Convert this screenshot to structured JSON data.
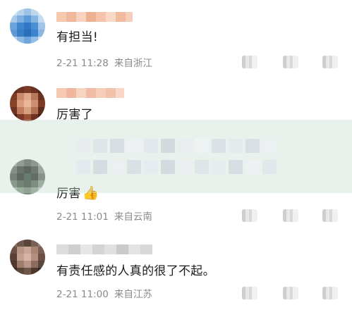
{
  "comments": [
    {
      "text": "有担当!",
      "time": "2-21 11:28",
      "location": "来自浙江"
    },
    {
      "text": "厉害了",
      "time": "",
      "location": ""
    },
    {
      "text": "厉害",
      "emoji": "👍",
      "time": "2-21 11:01",
      "location": "来自云南"
    },
    {
      "text": "有责任感的人真的很了不起。",
      "time": "2-21 11:00",
      "location": "来自江苏"
    }
  ],
  "banner": {
    "title": ""
  },
  "colors": {
    "meta_text": "#8a8a8a",
    "comment_text": "#1b1b1b",
    "banner_tint": "#bed7c8"
  }
}
